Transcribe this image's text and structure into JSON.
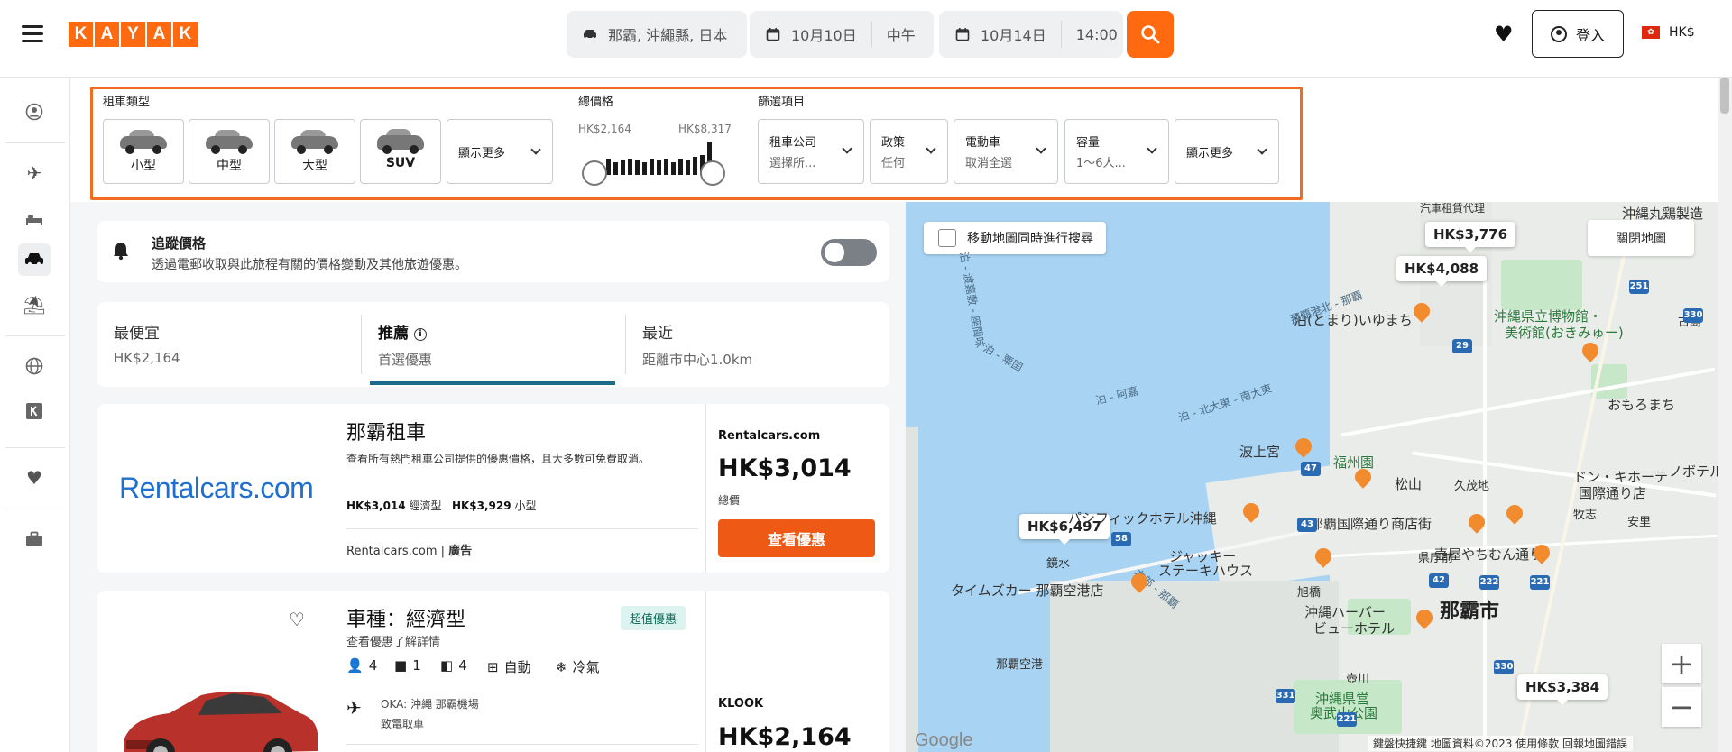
{
  "header": {
    "logo_letters": [
      "K",
      "A",
      "Y",
      "A",
      "K"
    ],
    "location": "那霸, 沖繩縣, 日本",
    "pickup_date": "10月10日",
    "pickup_time": "中午",
    "dropoff_date": "10月14日",
    "dropoff_time": "14:00",
    "login_label": "登入",
    "currency": "HK$",
    "flag_glyph": "✿",
    "accent_color": "#ff690f"
  },
  "sidebar": {
    "icons": [
      "user-icon",
      "flight-icon",
      "hotel-icon",
      "car-icon",
      "beach-icon",
      "globe-icon",
      "kayak-k-icon",
      "heart-icon",
      "briefcase-icon"
    ]
  },
  "filters": {
    "car_type_label": "租車類型",
    "car_types": [
      "小型",
      "中型",
      "大型",
      "SUV"
    ],
    "car_show_more": "顯示更多",
    "price_label": "總價格",
    "price_min": "HK$2,164",
    "price_max": "HK$8,317",
    "filter_label": "篩選項目",
    "dropdowns": [
      {
        "title": "租車公司",
        "value": "選擇所..."
      },
      {
        "title": "政策",
        "value": "任何"
      },
      {
        "title": "電動車",
        "value": "取消全選"
      },
      {
        "title": "容量",
        "value": "1～6人..."
      }
    ],
    "filter_show_more": "顯示更多"
  },
  "price_alert": {
    "title": "追蹤價格",
    "subtitle": "透過電郵收取與此旅程有關的價格變動及其他旅遊優惠。"
  },
  "sort_tabs": [
    {
      "title": "最便宜",
      "subtitle": "HK$2,164"
    },
    {
      "title": "推薦",
      "subtitle": "首選優惠"
    },
    {
      "title": "最近",
      "subtitle": "距離市中心1.0km"
    }
  ],
  "result_ad": {
    "logo_text": "Rentalcars.com",
    "title": "那霸租車",
    "description": "查看所有熱門租車公司提供的優惠價格，且大多數可免費取消。",
    "price1": "HK$3,014",
    "price1_label": "經濟型",
    "price2": "HK$3,929",
    "price2_label": "小型",
    "footer_site": "Rentalcars.com",
    "footer_sep": "|",
    "footer_ad": "廣告",
    "provider": "Rentalcars.com",
    "total_price": "HK$3,014",
    "total_label": "總價",
    "cta": "查看優惠"
  },
  "result_car": {
    "title": "車種：經濟型",
    "subtitle": "查看優惠了解詳情",
    "badge": "超值優惠",
    "features": [
      {
        "icon": "person-icon",
        "glyph": "👤",
        "text": "4"
      },
      {
        "icon": "bag-icon",
        "glyph": "■",
        "text": "1"
      },
      {
        "icon": "door-icon",
        "glyph": "◧",
        "text": "4"
      },
      {
        "icon": "transmission-icon",
        "glyph": "⊞",
        "text": "自動"
      },
      {
        "icon": "snowflake-icon",
        "glyph": "❄",
        "text": "冷氣"
      }
    ],
    "pickup_line1": "OKA: 沖繩 那霸機場",
    "pickup_line2": "致電取車",
    "provider": "KLOOK",
    "price": "HK$2,164"
  },
  "map": {
    "search_on_move": "移動地圖同時進行搜尋",
    "close_label": "關閉地圖",
    "pins": [
      "HK$3,776",
      "HK$4,088",
      "HK$6,497",
      "HK$3,384"
    ],
    "labels": {
      "naha_city": "那霸市",
      "tomari": "泊(とまり)いゆまち",
      "museum1": "沖縄県立博物館・",
      "museum2": "美術館(おきみゅー)",
      "naminoue": "波上宮",
      "fukushu": "福州園",
      "matsuyama": "松山",
      "kumoji": "久茂地",
      "pacific": "パシフィックホテル沖縄",
      "donki1": "ドン・キホーテ",
      "donki2": "国際通り店",
      "kokusai": "那覇国際通り商店街",
      "tsuboya": "壺屋やちむん通り",
      "jackie1": "ジャッキー",
      "jackie2": "ステーキハウス",
      "prefecture_office": "県庁前",
      "asahibashi": "旭橋",
      "harbor1": "沖縄ハーバー",
      "harbor2": "ビューホテル",
      "times": "タイムズカー 那覇空港店",
      "kagamizu": "鏡水",
      "airport": "那覇空港",
      "park1": "沖縄県営",
      "park2": "奥武山公園",
      "tsuboyagawa": "壺川",
      "makishi": "牧志",
      "asato": "安里",
      "omoromachi": "おもろまち",
      "furujima": "古島",
      "marudama": "沖縄丸鶏製造",
      "nobotel": "ノボテル沖縄",
      "rental_agency": "汽車租賃代理",
      "sea1": "泊 - 渡嘉敷 - 座間味",
      "sea2": "泊 - 北大東 - 南大東",
      "sea3": "泊 - 粟国",
      "sea4": "泊 - 阿嘉",
      "sea5": "那覇港北 - 那覇",
      "road_naha": "本部 - 那覇"
    },
    "shields": [
      "251",
      "330",
      "29",
      "47",
      "43",
      "58",
      "42",
      "222",
      "221",
      "331",
      "330",
      "221"
    ],
    "google": "Google",
    "footer": "鍵盤快捷鍵  地圖資料©2023  使用條款  回報地圖錯誤"
  }
}
